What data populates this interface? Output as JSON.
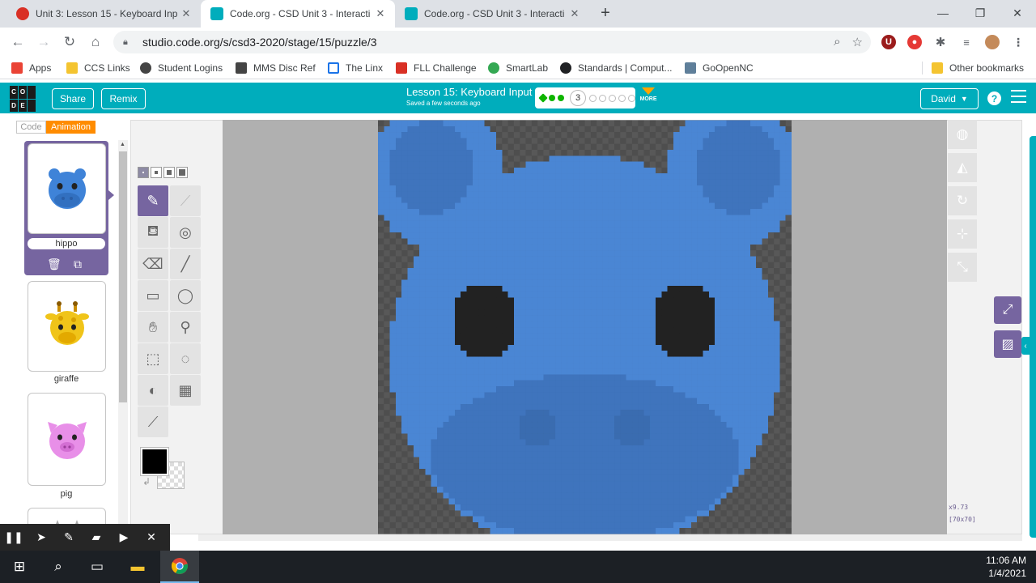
{
  "browser": {
    "tabs": [
      {
        "title": "Unit 3: Lesson 15 - Keyboard Inp",
        "active": false,
        "icon_color": "#d93025"
      },
      {
        "title": "Code.org - CSD Unit 3 - Interacti",
        "active": true,
        "icon_color": "#00adbc"
      },
      {
        "title": "Code.org - CSD Unit 3 - Interacti",
        "active": false,
        "icon_color": "#00adbc"
      }
    ],
    "new_tab_glyph": "+",
    "url": "studio.code.org/s/csd3-2020/stage/15/puzzle/3",
    "bookmarks": [
      {
        "label": "Apps",
        "icon_color": "#ea4335"
      },
      {
        "label": "CCS Links",
        "icon_color": "#f4c430"
      },
      {
        "label": "Student Logins",
        "icon_color": "#444444"
      },
      {
        "label": "MMS Disc Ref",
        "icon_color": "#444444"
      },
      {
        "label": "The Linx",
        "icon_color": "#1a73e8"
      },
      {
        "label": "FLL Challenge",
        "icon_color": "#d93025"
      },
      {
        "label": "SmartLab",
        "icon_color": "#34a853"
      },
      {
        "label": "Standards | Comput...",
        "icon_color": "#202124"
      },
      {
        "label": "GoOpenNC",
        "icon_color": "#5f7f9a"
      }
    ],
    "other_bookmarks": "Other bookmarks"
  },
  "header": {
    "share_label": "Share",
    "remix_label": "Remix",
    "lesson_title": "Lesson 15: Keyboard Input",
    "save_status": "Saved a few seconds ago",
    "current_level": "3",
    "more_label": "MORE",
    "user_name": "David",
    "help_glyph": "?",
    "accent_color": "#00adbc"
  },
  "mode_toggle": {
    "code": "Code",
    "animation": "Animation",
    "selected": "Animation"
  },
  "animations": [
    {
      "name": "hippo",
      "selected": true,
      "color": "#3f83d8"
    },
    {
      "name": "giraffe",
      "selected": false,
      "color": "#f0c419"
    },
    {
      "name": "pig",
      "selected": false,
      "color": "#e88fe8"
    }
  ],
  "editor": {
    "zoom_label": "x9.73",
    "size_label": "[70x70]",
    "primary_color": "#000000",
    "selected_tool": "pencil-icon"
  },
  "clock": {
    "time": "11:06 AM",
    "date": "1/4/2021"
  }
}
